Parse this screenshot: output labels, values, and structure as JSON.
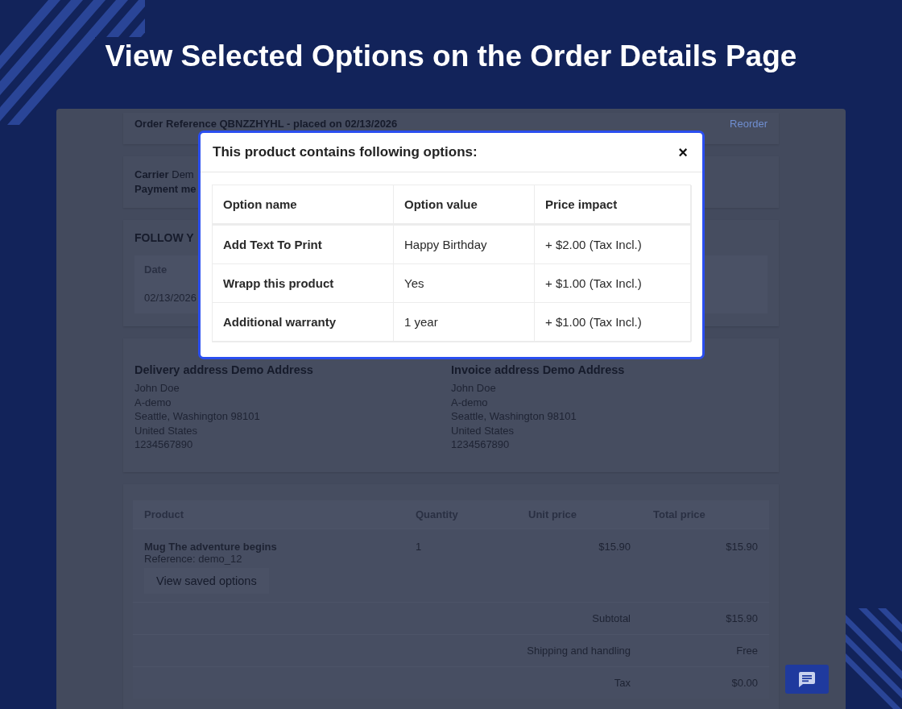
{
  "heading": "View Selected Options on the Order Details Page",
  "order": {
    "reference": "Order Reference QBNZZHYHL - placed on 02/13/2026",
    "reorder": "Reorder"
  },
  "shipping": {
    "carrier": "**Carrier** Dem",
    "payment": "Payment me"
  },
  "follow": {
    "title": "FOLLOW Y",
    "columns": [
      "Date"
    ],
    "rows": [
      [
        "02/13/2026"
      ]
    ]
  },
  "addresses": [
    {
      "title": "Delivery address Demo Address",
      "lines": [
        "John Doe",
        "A-demo",
        "Seattle, Washington 98101",
        "United States",
        "1234567890"
      ]
    },
    {
      "title": "Invoice address Demo Address",
      "lines": [
        "John Doe",
        "A-demo",
        "Seattle, Washington 98101",
        "United States",
        "1234567890"
      ]
    }
  ],
  "products": {
    "columns": [
      "Product",
      "Quantity",
      "Unit price",
      "Total price"
    ],
    "rows": [
      {
        "name": "Mug The adventure begins",
        "reference": "Reference: demo_12",
        "button": "View saved options",
        "quantity": "1",
        "unit_price": "$15.90",
        "total_price": "$15.90"
      }
    ],
    "totals": [
      {
        "label": "Subtotal",
        "value": "$15.90"
      },
      {
        "label": "Shipping and handling",
        "value": "Free"
      },
      {
        "label": "Tax",
        "value": "$0.00"
      }
    ]
  },
  "modal": {
    "title": "This product contains following options:",
    "close": "×",
    "columns": [
      "Option name",
      "Option value",
      "Price impact"
    ],
    "rows": [
      [
        "Add Text To Print",
        "Happy Birthday",
        "+ $2.00 (Tax Incl.)"
      ],
      [
        "Wrapp this product",
        "Yes",
        "+ $1.00 (Tax Incl.)"
      ],
      [
        "Additional warranty",
        "1 year",
        "+ $1.00 (Tax Incl.)"
      ]
    ]
  }
}
